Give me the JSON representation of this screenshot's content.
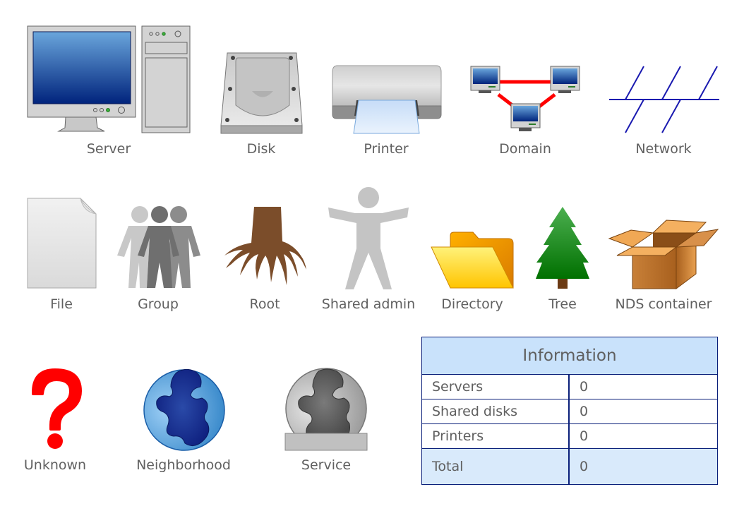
{
  "shapes": {
    "server": "Server",
    "disk": "Disk",
    "printer": "Printer",
    "domain": "Domain",
    "network": "Network",
    "file": "File",
    "group": "Group",
    "root": "Root",
    "shared_admin": "Shared admin",
    "directory": "Directory",
    "tree": "Tree",
    "nds_container": "NDS container",
    "unknown": "Unknown",
    "neighborhood": "Neighborhood",
    "service": "Service"
  },
  "info_table": {
    "title": "Information",
    "rows": [
      {
        "label": "Servers",
        "value": "0"
      },
      {
        "label": "Shared disks",
        "value": "0"
      },
      {
        "label": "Printers",
        "value": "0"
      }
    ],
    "total": {
      "label": "Total",
      "value": "0"
    }
  },
  "colors": {
    "table_border": "#0a1f7a",
    "table_header_bg": "#c9e2fb",
    "table_total_bg": "#d9eafb",
    "network_line": "#1a1ab0",
    "domain_link": "#ff0000"
  }
}
